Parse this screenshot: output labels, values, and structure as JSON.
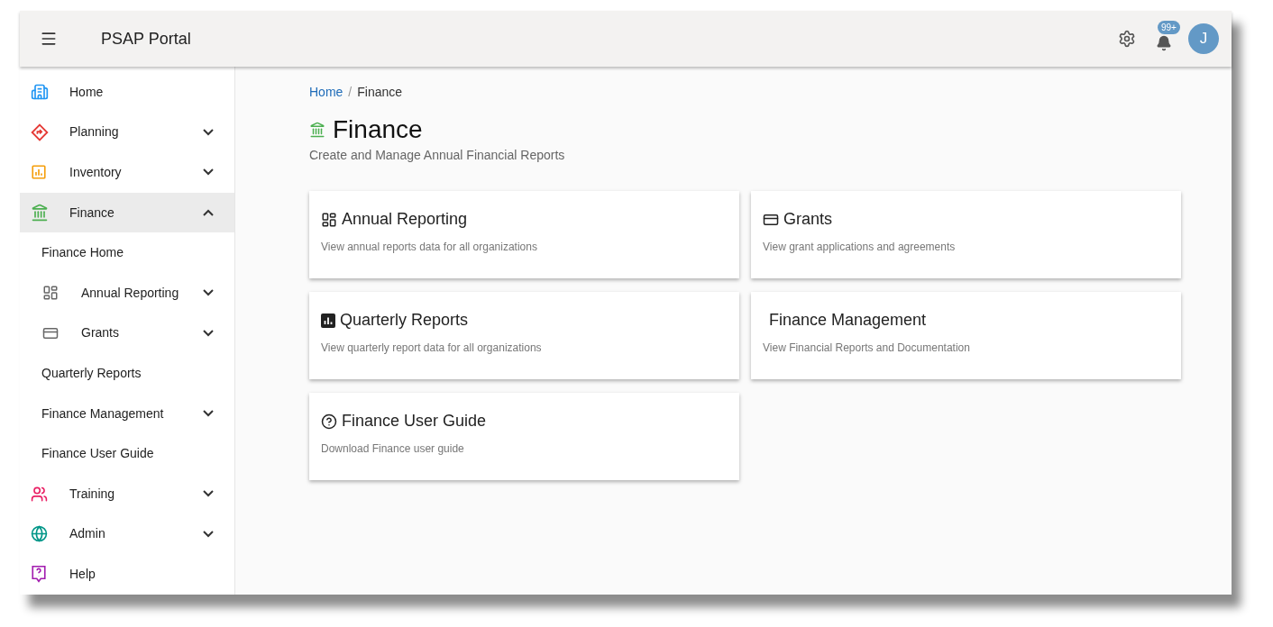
{
  "header": {
    "title": "PSAP Portal",
    "notification_badge": "99+",
    "avatar_initial": "J"
  },
  "sidebar": {
    "items": [
      {
        "label": "Home",
        "selected": false
      },
      {
        "label": "Planning",
        "selected": false,
        "expanded": false
      },
      {
        "label": "Inventory",
        "selected": false,
        "expanded": false
      },
      {
        "label": "Finance",
        "selected": true,
        "expanded": true,
        "children": [
          {
            "label": "Finance Home",
            "selected": false
          },
          {
            "label": "Annual Reporting",
            "selected": false,
            "expanded": false
          },
          {
            "label": "Grants",
            "selected": false,
            "expanded": false
          },
          {
            "label": "Quarterly Reports",
            "selected": false
          },
          {
            "label": "Finance Management",
            "selected": false,
            "expanded": false
          },
          {
            "label": "Finance User Guide",
            "selected": false
          }
        ]
      },
      {
        "label": "Training",
        "selected": false,
        "expanded": false
      },
      {
        "label": "Admin",
        "selected": false,
        "expanded": false
      },
      {
        "label": "Help",
        "selected": false
      }
    ]
  },
  "breadcrumb": [
    "Home",
    "Finance"
  ],
  "breadcrumb_separator": "/",
  "page": {
    "title": "Finance",
    "subtitle": "Create and Manage Annual Financial Reports"
  },
  "cards": [
    {
      "title": "Annual Reporting",
      "description": "View annual reports data for all organizations"
    },
    {
      "title": "Grants",
      "description": "View grant applications and agreements"
    },
    {
      "title": "Quarterly Reports",
      "description": "View quarterly report data for all organizations"
    },
    {
      "title": "Finance Management",
      "description": "View Financial Reports and Documentation"
    },
    {
      "title": "Finance User Guide",
      "description": "Download Finance user guide"
    }
  ]
}
